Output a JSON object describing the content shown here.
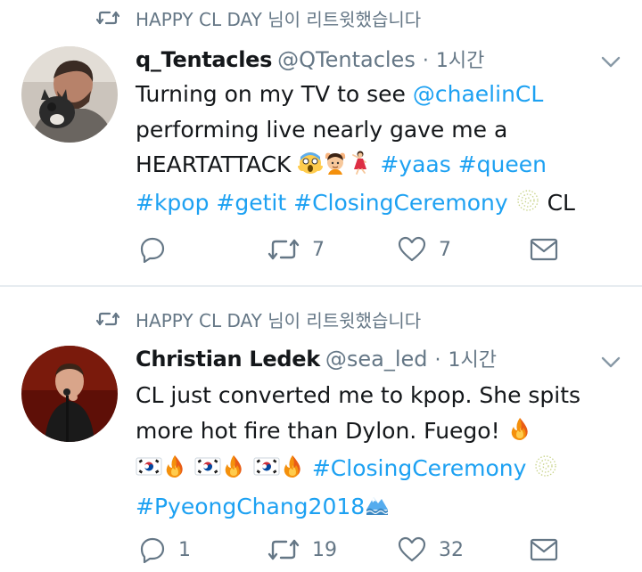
{
  "tweets": [
    {
      "retweet_label": "HAPPY CL DAY 님이 리트윗했습니다",
      "name": "q_Tentacles",
      "handle": "@QTentacles",
      "separator": "·",
      "time": "1시간",
      "lines": [
        [
          {
            "t": "Turning on my TV to see "
          },
          {
            "t": "@chaelinCL",
            "link": true
          }
        ],
        [
          {
            "t": "performing live nearly gave me a"
          }
        ],
        [
          {
            "t": "HEARTATTACK "
          },
          {
            "emoji": "scream"
          },
          {
            "emoji": "gesture"
          },
          {
            "emoji": "dancer"
          },
          {
            "t": " "
          },
          {
            "t": "#yaas",
            "link": true
          },
          {
            "t": " "
          },
          {
            "t": "#queen",
            "link": true
          }
        ],
        [
          {
            "t": "#kpop",
            "link": true
          },
          {
            "t": " "
          },
          {
            "t": "#getit",
            "link": true
          },
          {
            "t": " "
          },
          {
            "t": "#ClosingCeremony",
            "link": true
          },
          {
            "t": " "
          },
          {
            "emoji": "torch"
          },
          {
            "t": "  CL"
          }
        ]
      ],
      "reply_count": "",
      "retweet_count": "7",
      "like_count": "7"
    },
    {
      "retweet_label": "HAPPY CL DAY 님이 리트윗했습니다",
      "name": "Christian Ledek",
      "handle": "@sea_led",
      "separator": "·",
      "time": "1시간",
      "lines": [
        [
          {
            "t": "CL just converted me to kpop.  She spits"
          }
        ],
        [
          {
            "t": "more hot fire than Dylon.  Fuego!  "
          },
          {
            "emoji": "fire"
          }
        ],
        [
          {
            "emoji": "kr"
          },
          {
            "emoji": "fire"
          },
          {
            "t": " "
          },
          {
            "emoji": "kr"
          },
          {
            "emoji": "fire"
          },
          {
            "t": " "
          },
          {
            "emoji": "kr"
          },
          {
            "emoji": "fire"
          },
          {
            "t": " "
          },
          {
            "t": "#ClosingCeremony",
            "link": true
          },
          {
            "t": " "
          },
          {
            "emoji": "torch"
          }
        ],
        [
          {
            "t": "#PyeongChang2018",
            "link": true
          },
          {
            "emoji": "mountain"
          }
        ]
      ],
      "reply_count": "1",
      "retweet_count": "19",
      "like_count": "32"
    }
  ],
  "icons": {
    "retweet_indicator": "retweet-icon",
    "reply": "reply-icon",
    "retweet": "retweet-icon",
    "like": "heart-icon",
    "message": "envelope-icon",
    "menu": "chevron-down-icon"
  },
  "colors": {
    "link": "#1da1f2",
    "secondary_text": "#657786",
    "primary_text": "#14171a",
    "divider": "#e6ecf0"
  }
}
